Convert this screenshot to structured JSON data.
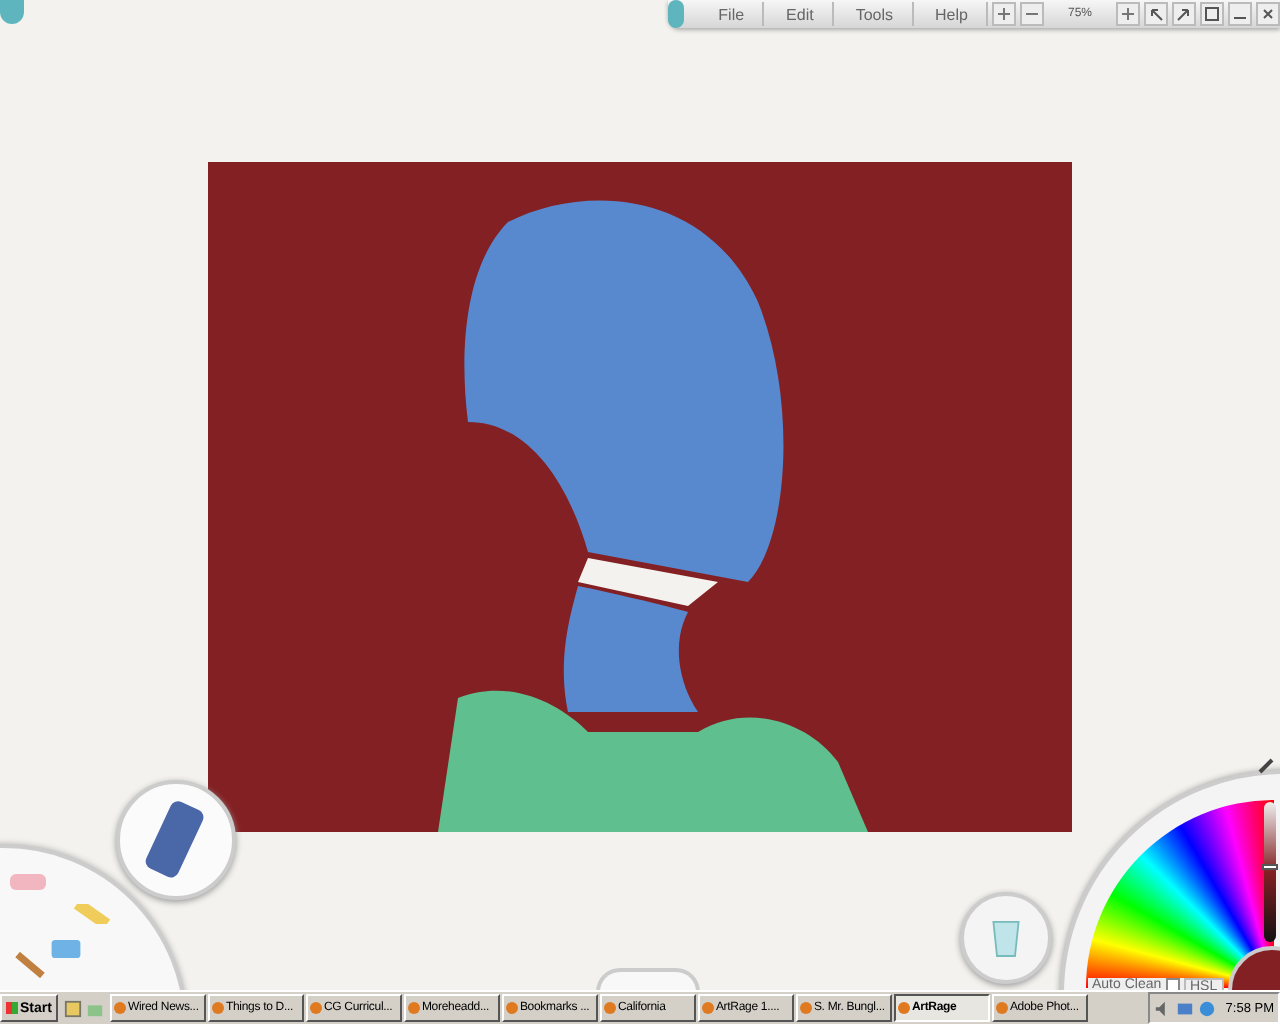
{
  "menu_bar": {
    "items": [
      "File",
      "Edit",
      "Tools",
      "Help"
    ],
    "zoom": "75%"
  },
  "color_picker": {
    "lightness": {
      "level": 0.55
    },
    "auto_clean": {
      "label": "Auto Clean",
      "checked": false
    },
    "mode": "HSL"
  },
  "taskbar": {
    "start": "Start",
    "tasks": [
      {
        "label": "Wired News...",
        "selected": false
      },
      {
        "label": "Things to D...",
        "selected": false
      },
      {
        "label": "CG Curricul...",
        "selected": false
      },
      {
        "label": "Moreheadd...",
        "selected": false
      },
      {
        "label": "Bookmarks ...",
        "selected": false
      },
      {
        "label": "California",
        "selected": false
      },
      {
        "label": "ArtRage 1....",
        "selected": false
      },
      {
        "label": "S. Mr. Bungl...",
        "selected": false
      },
      {
        "label": "ArtRage",
        "selected": true
      },
      {
        "label": "Adobe Phot...",
        "selected": false
      }
    ],
    "clock": "7:58 PM"
  }
}
